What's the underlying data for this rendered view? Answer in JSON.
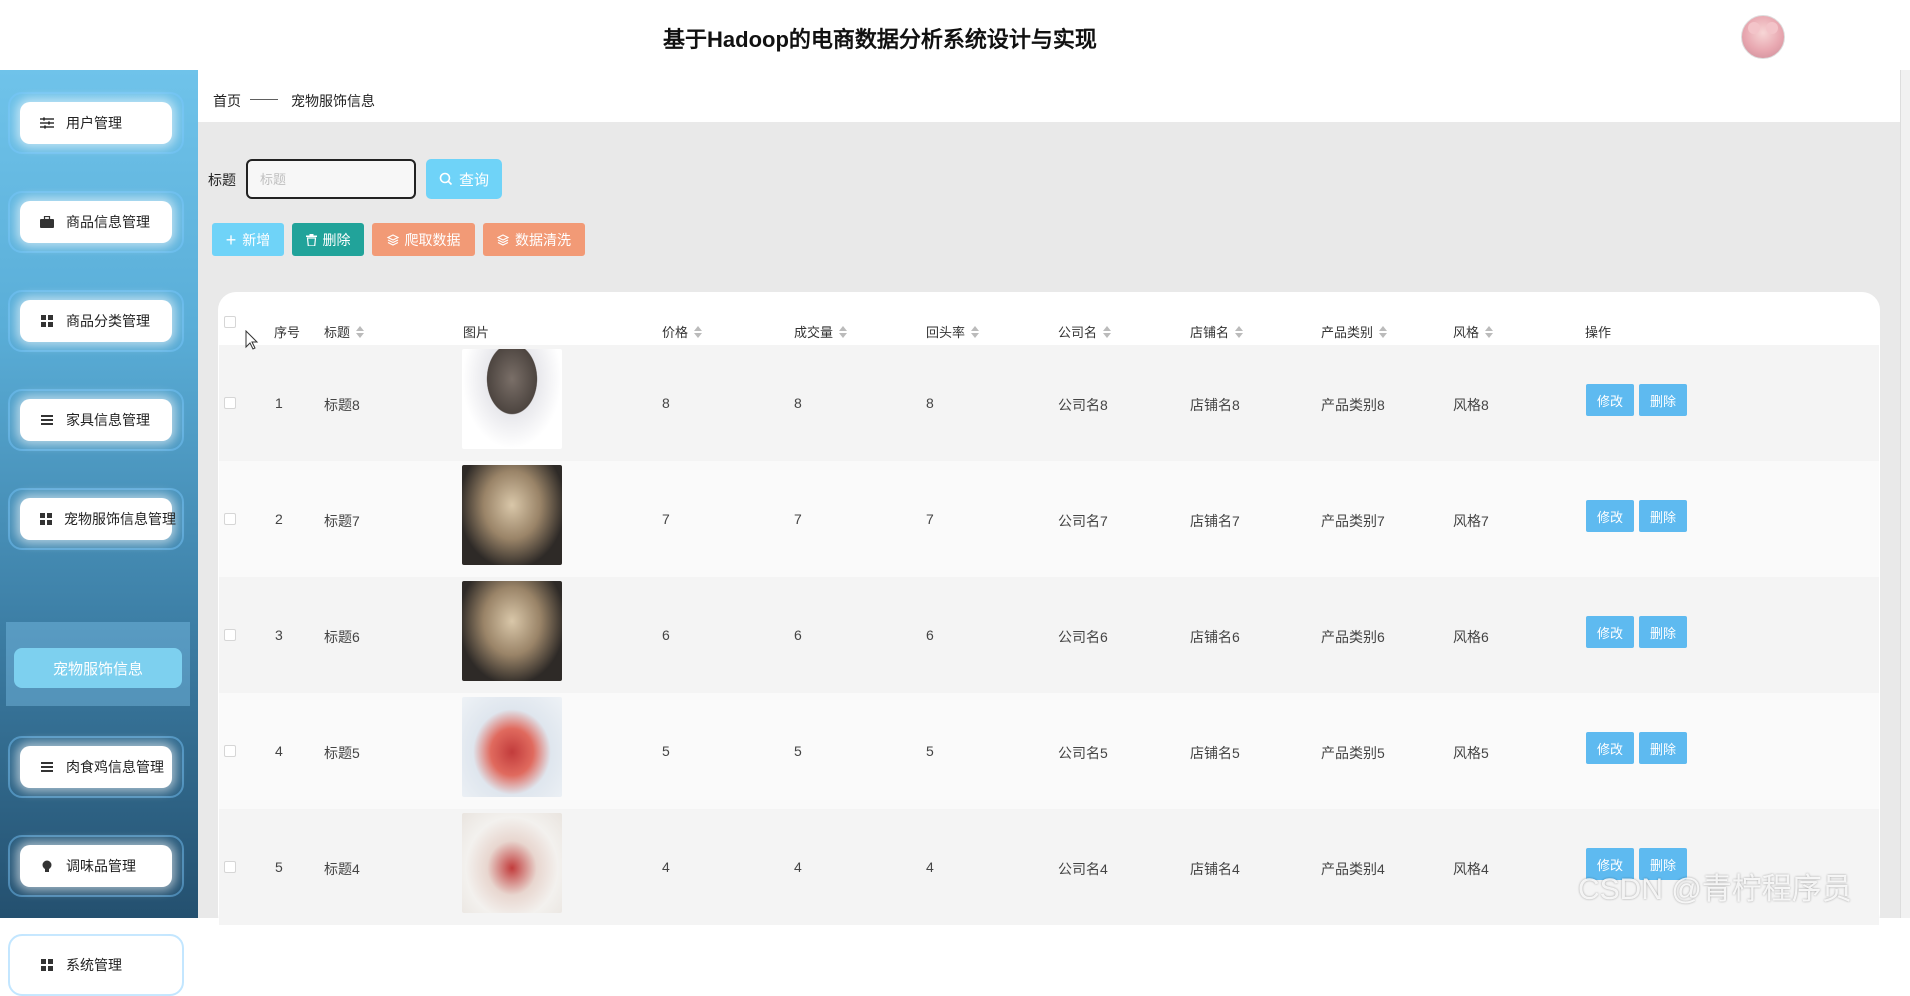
{
  "app": {
    "title": "基于Hadoop的电商数据分析系统设计与实现"
  },
  "sidebar": {
    "items": [
      {
        "label": "用户管理",
        "icon": "sliders-icon"
      },
      {
        "label": "商品信息管理",
        "icon": "briefcase-icon"
      },
      {
        "label": "商品分类管理",
        "icon": "grid-icon"
      },
      {
        "label": "家具信息管理",
        "icon": "list-icon"
      },
      {
        "label": "宠物服饰信息管理",
        "icon": "grid-icon"
      },
      {
        "label": "肉食鸡信息管理",
        "icon": "list-icon"
      },
      {
        "label": "调味品管理",
        "icon": "bulb-icon"
      },
      {
        "label": "系统管理",
        "icon": "grid-icon"
      }
    ],
    "active_sub": "宠物服饰信息"
  },
  "breadcrumb": {
    "home": "首页",
    "separator": "——",
    "current": "宠物服饰信息"
  },
  "search": {
    "label": "标题",
    "placeholder": "标题",
    "button": "查询"
  },
  "toolbar": {
    "add": "新增",
    "delete": "删除",
    "crawl": "爬取数据",
    "clean": "数据清洗"
  },
  "colors": {
    "add": "#6fd3f8",
    "delete": "#21a39a",
    "crawl": "#f29a76",
    "clean": "#f29a76",
    "action": "#5ebaf0"
  },
  "table": {
    "columns": [
      "序号",
      "标题",
      "图片",
      "价格",
      "成交量",
      "回头率",
      "公司名",
      "店铺名",
      "产品类别",
      "风格",
      "操作"
    ],
    "rows": [
      {
        "no": "1",
        "title": "标题8",
        "price": "8",
        "volume": "8",
        "repeat": "8",
        "company": "公司名8",
        "shop": "店铺名8",
        "category": "产品类别8",
        "style": "风格8"
      },
      {
        "no": "2",
        "title": "标题7",
        "price": "7",
        "volume": "7",
        "repeat": "7",
        "company": "公司名7",
        "shop": "店铺名7",
        "category": "产品类别7",
        "style": "风格7"
      },
      {
        "no": "3",
        "title": "标题6",
        "price": "6",
        "volume": "6",
        "repeat": "6",
        "company": "公司名6",
        "shop": "店铺名6",
        "category": "产品类别6",
        "style": "风格6"
      },
      {
        "no": "4",
        "title": "标题5",
        "price": "5",
        "volume": "5",
        "repeat": "5",
        "company": "公司名5",
        "shop": "店铺名5",
        "category": "产品类别5",
        "style": "风格5"
      },
      {
        "no": "5",
        "title": "标题4",
        "price": "4",
        "volume": "4",
        "repeat": "4",
        "company": "公司名4",
        "shop": "店铺名4",
        "category": "产品类别4",
        "style": "风格4"
      }
    ],
    "actions": {
      "edit": "修改",
      "delete": "删除"
    }
  },
  "watermark": "CSDN @青柠程序员"
}
